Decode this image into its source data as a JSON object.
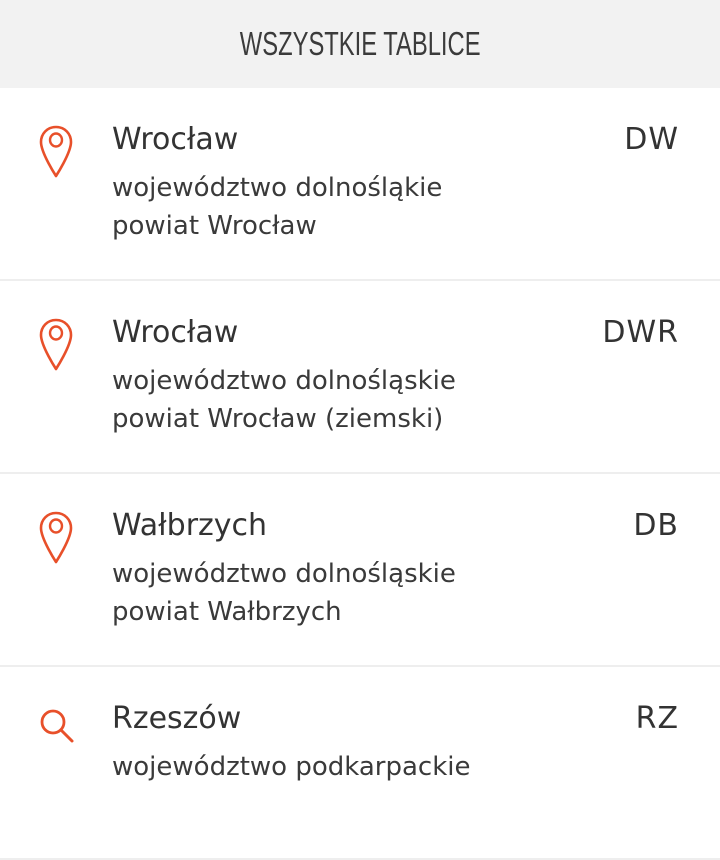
{
  "header": {
    "title": "WSZYSTKIE TABLICE"
  },
  "colors": {
    "accent": "#e8502a",
    "header_bg": "#f2f2f2",
    "text": "#333333",
    "divider": "#eeeeee"
  },
  "plates": [
    {
      "icon": "map-pin-icon",
      "city": "Wrocław",
      "code": "DW",
      "voivodeship": "województwo dolnośląkie",
      "powiat": "powiat Wrocław"
    },
    {
      "icon": "map-pin-icon",
      "city": "Wrocław",
      "code": "DWR",
      "voivodeship": "województwo dolnośląskie",
      "powiat": "powiat Wrocław (ziemski)"
    },
    {
      "icon": "map-pin-icon",
      "city": "Wałbrzych",
      "code": "DB",
      "voivodeship": "województwo dolnośląskie",
      "powiat": "powiat Wałbrzych"
    },
    {
      "icon": "search-icon",
      "city": "Rzeszów",
      "code": "RZ",
      "voivodeship": "województwo podkarpackie",
      "powiat": ""
    }
  ]
}
